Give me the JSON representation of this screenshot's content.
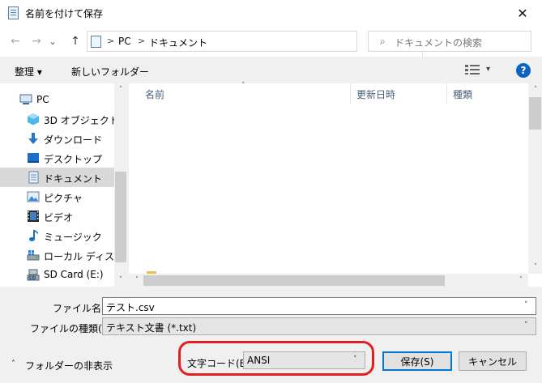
{
  "window": {
    "title": "名前を付けて保存",
    "close_glyph": "✕"
  },
  "nav": {
    "back_glyph": "←",
    "forward_glyph": "→",
    "recent_glyph": "⌄",
    "up_glyph": "↑",
    "path": [
      "PC",
      "ドキュメント"
    ],
    "path_sep": ">",
    "refresh_glyph": "↻",
    "search_placeholder": "ドキュメントの検索"
  },
  "toolbar": {
    "organize": "整理 ▾",
    "new_folder": "新しいフォルダー",
    "view_caret": "▾",
    "help": "?"
  },
  "tree": [
    {
      "label": "PC",
      "icon": "computer-icon"
    },
    {
      "label": "3D オブジェクト",
      "icon": "3d-objects-icon"
    },
    {
      "label": "ダウンロード",
      "icon": "download-icon"
    },
    {
      "label": "デスクトップ",
      "icon": "desktop-icon"
    },
    {
      "label": "ドキュメント",
      "icon": "document-icon",
      "selected": true
    },
    {
      "label": "ピクチャ",
      "icon": "pictures-icon"
    },
    {
      "label": "ビデオ",
      "icon": "video-icon"
    },
    {
      "label": "ミュージック",
      "icon": "music-icon"
    },
    {
      "label": "ローカル ディスク (C",
      "icon": "local-disk-icon"
    },
    {
      "label": "SD Card (E:)",
      "icon": "sd-card-icon"
    }
  ],
  "columns": {
    "name": "名前",
    "modified": "更新日時",
    "type": "種類"
  },
  "form": {
    "filename_label": "ファイル名(N):",
    "filename_value": "テスト.csv",
    "filetype_label": "ファイルの種類(T):",
    "filetype_value": "テキスト文書 (*.txt)",
    "encoding_label": "文字コード(E):",
    "encoding_value": "ANSI",
    "hide_folders": "フォルダーの非表示",
    "save": "保存(S)",
    "cancel": "キャンセル"
  },
  "colors": {
    "accent": "#0078d7",
    "highlight": "#e02020"
  }
}
